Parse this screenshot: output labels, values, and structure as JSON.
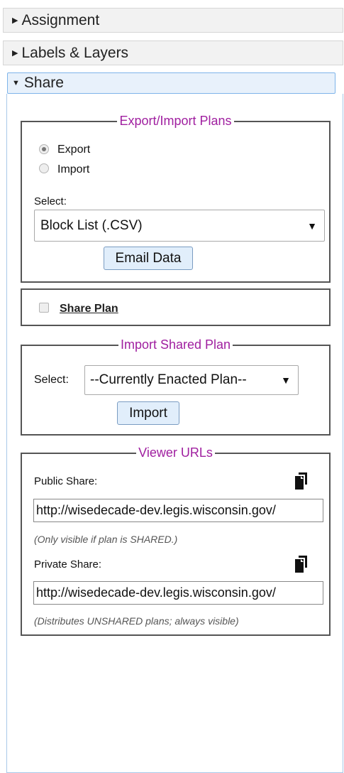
{
  "accordion": {
    "assignment": "Assignment",
    "labels_layers": "Labels & Layers",
    "share": "Share"
  },
  "export_import": {
    "legend": "Export/Import Plans",
    "export_label": "Export",
    "import_label": "Import",
    "selected_mode": "Export",
    "select_label": "Select:",
    "select_value": "Block List (.CSV)",
    "email_button": "Email Data"
  },
  "share_plan": {
    "label": "Share Plan",
    "checked": false
  },
  "import_shared": {
    "legend": "Import Shared Plan",
    "select_label": "Select:",
    "select_value": "--Currently Enacted Plan--",
    "import_button": "Import"
  },
  "viewer_urls": {
    "legend": "Viewer URLs",
    "public_label": "Public Share:",
    "public_url": "http://wisedecade-dev.legis.wisconsin.gov/",
    "public_note": "(Only visible if plan is SHARED.)",
    "private_label": "Private Share:",
    "private_url": "http://wisedecade-dev.legis.wisconsin.gov/",
    "private_note": "(Distributes UNSHARED plans; always visible)"
  },
  "icons": {
    "collapsed": "triangle-right-icon",
    "expanded": "triangle-down-icon",
    "copy": "copy-icon",
    "select_arrow": "chevron-down-icon"
  }
}
